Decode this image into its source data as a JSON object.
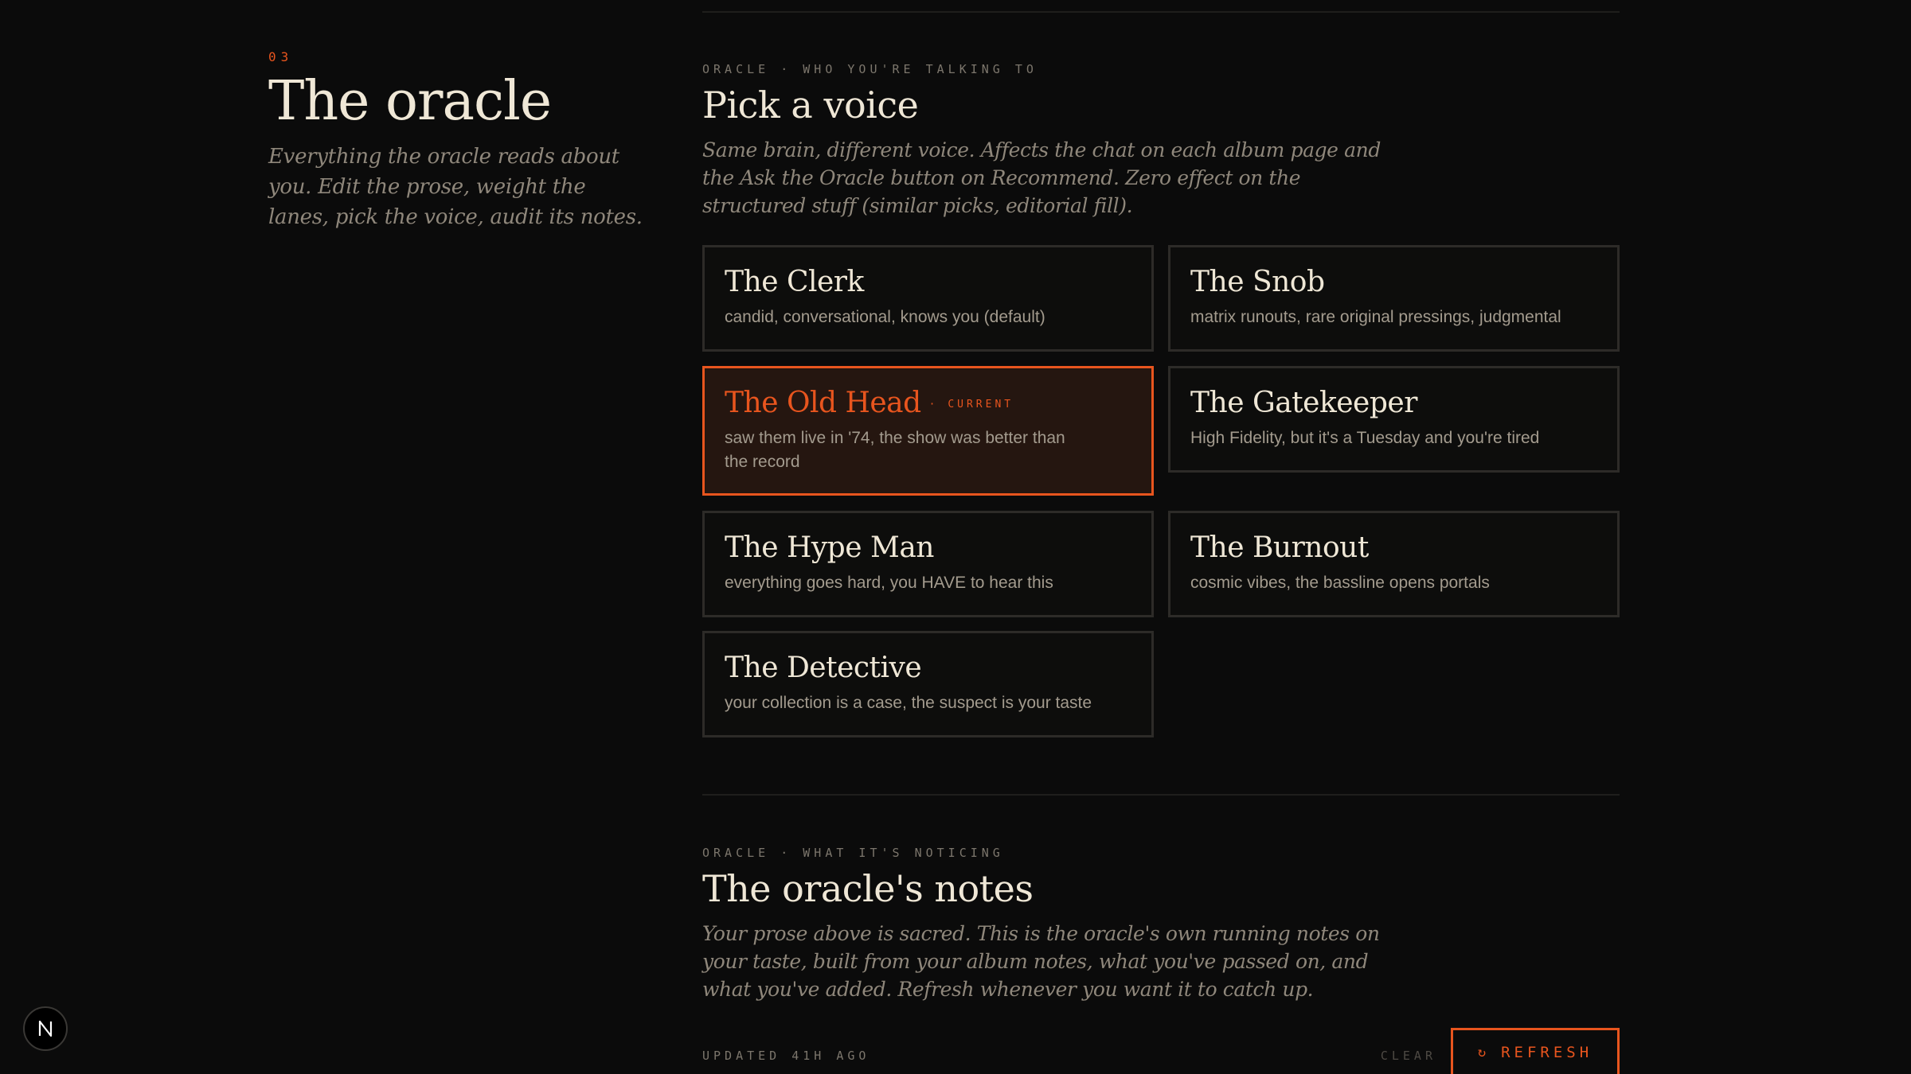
{
  "section": {
    "number": "03",
    "title": "The oracle",
    "subtitle": "Everything the oracle reads about you. Edit the prose, weight the lanes, pick the voice, audit its notes."
  },
  "voice": {
    "eyebrow": "ORACLE · WHO YOU'RE TALKING TO",
    "title": "Pick a voice",
    "description": "Same brain, different voice. Affects the chat on each album page and the Ask the Oracle button on Recommend. Zero effect on the structured stuff (similar picks, editorial fill).",
    "current_label": "· CURRENT",
    "options": [
      {
        "name": "The Clerk",
        "desc": "candid, conversational, knows you (default)"
      },
      {
        "name": "The Snob",
        "desc": "matrix runouts, rare original pressings, judgmental"
      },
      {
        "name": "The Old Head",
        "desc": "saw them live in '74, the show was better than the record"
      },
      {
        "name": "The Gatekeeper",
        "desc": "High Fidelity, but it's a Tuesday and you're tired"
      },
      {
        "name": "The Hype Man",
        "desc": "everything goes hard, you HAVE to hear this"
      },
      {
        "name": "The Burnout",
        "desc": "cosmic vibes, the bassline opens portals"
      },
      {
        "name": "The Detective",
        "desc": "your collection is a case, the suspect is your taste"
      }
    ]
  },
  "notes": {
    "eyebrow": "ORACLE · WHAT IT'S NOTICING",
    "title": "The oracle's notes",
    "description": "Your prose above is sacred. This is the oracle's own running notes on your taste, built from your album notes, what you've passed on, and what you've added. Refresh whenever you want it to catch up.",
    "updated": "UPDATED 41H AGO",
    "clear_label": "CLEAR",
    "refresh_label": "REFRESH",
    "refresh_icon": "refresh-icon"
  },
  "badge": {
    "letter": "N"
  },
  "colors": {
    "accent": "#e8551e",
    "background": "#0b0b0b",
    "text": "#efe7d6",
    "muted": "#8f877b"
  }
}
